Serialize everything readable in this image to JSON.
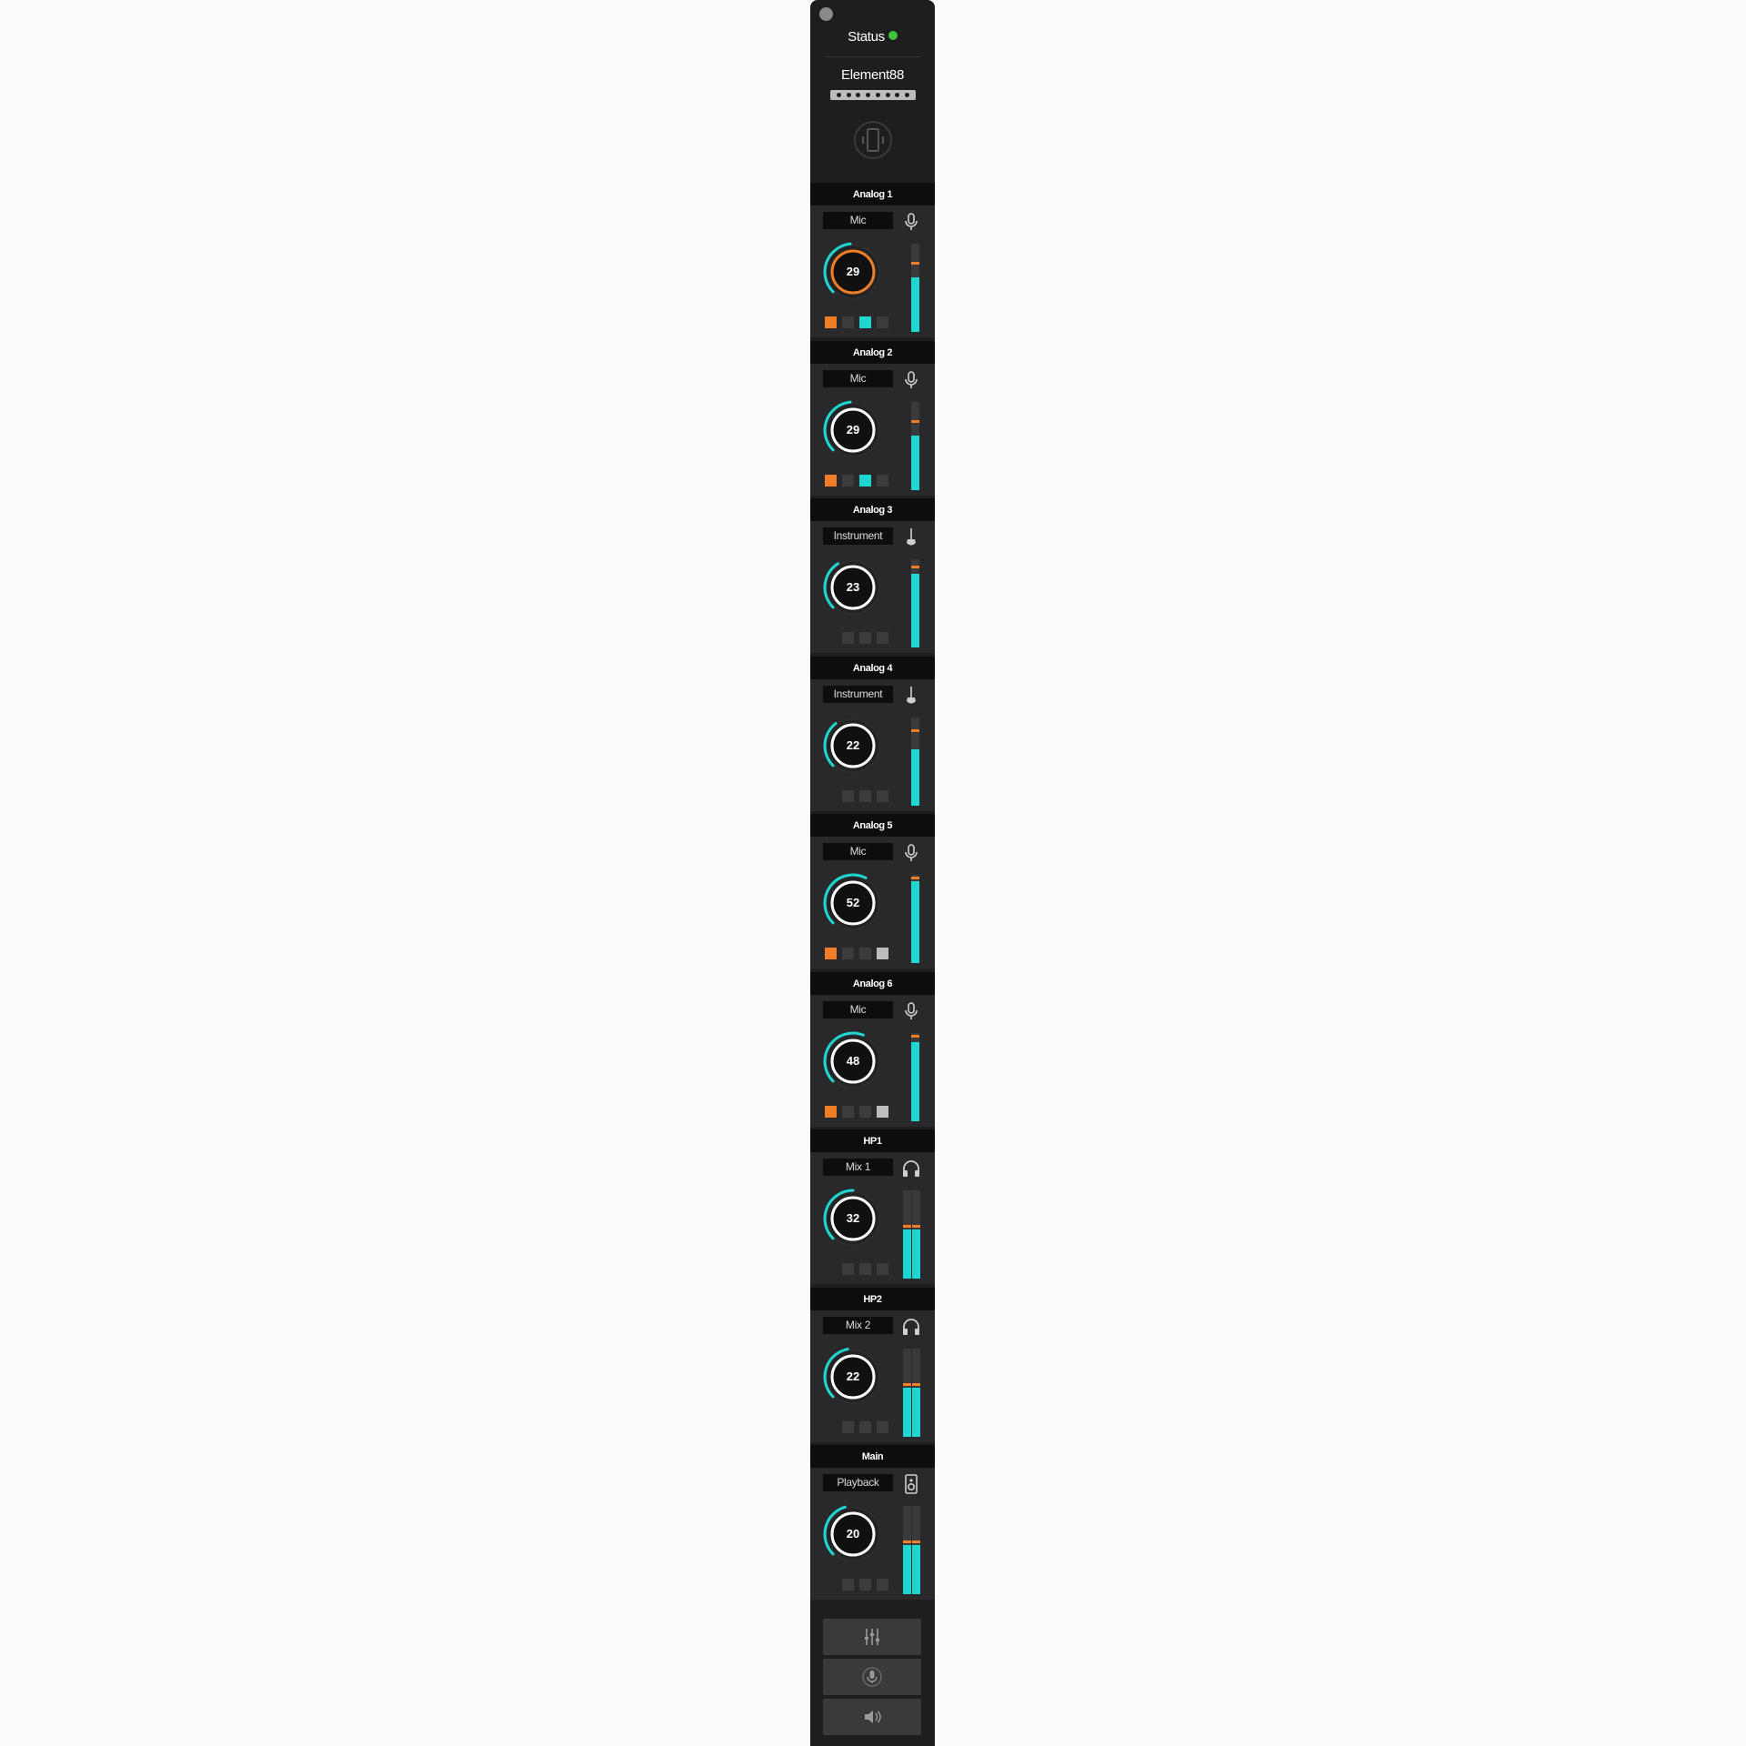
{
  "window": {
    "close_button": "close"
  },
  "status": {
    "label": "Status",
    "color": "#3ec33e"
  },
  "device": {
    "name": "Element88",
    "port_count": 8,
    "icon": "device-sync-icon"
  },
  "colors": {
    "accent": "#1fd6d0",
    "warning": "#f07e26",
    "background": "#1e1e1f"
  },
  "channels": [
    {
      "name": "Analog 1",
      "source": "Mic",
      "icon": "microphone-icon",
      "gain": "29",
      "gain_fraction": 0.48,
      "ring": "#f07e26",
      "buttons": [
        "#f07e26",
        "#3c3c3e",
        "#1fd6d0",
        "#3c3c3e"
      ],
      "meters": [
        {
          "level": 0.62,
          "peak": 0.76
        }
      ]
    },
    {
      "name": "Analog 2",
      "source": "Mic",
      "icon": "microphone-icon",
      "gain": "29",
      "gain_fraction": 0.48,
      "ring": "#ffffff",
      "buttons": [
        "#f07e26",
        "#3c3c3e",
        "#1fd6d0",
        "#3c3c3e"
      ],
      "meters": [
        {
          "level": 0.62,
          "peak": 0.76
        }
      ]
    },
    {
      "name": "Analog 3",
      "source": "Instrument",
      "icon": "guitar-icon",
      "gain": "23",
      "gain_fraction": 0.38,
      "ring": "#ffffff",
      "buttons": [
        null,
        "#3c3c3e",
        "#3c3c3e",
        "#3c3c3e"
      ],
      "meters": [
        {
          "level": 0.84,
          "peak": 0.9
        }
      ]
    },
    {
      "name": "Analog 4",
      "source": "Instrument",
      "icon": "guitar-icon",
      "gain": "22",
      "gain_fraction": 0.36,
      "ring": "#ffffff",
      "buttons": [
        null,
        "#3c3c3e",
        "#3c3c3e",
        "#3c3c3e"
      ],
      "meters": [
        {
          "level": 0.64,
          "peak": 0.84
        }
      ]
    },
    {
      "name": "Analog 5",
      "source": "Mic",
      "icon": "microphone-icon",
      "gain": "52",
      "gain_fraction": 0.6,
      "ring": "#ffffff",
      "buttons": [
        "#f07e26",
        "#3c3c3e",
        "#3c3c3e",
        "#bdbdbf"
      ],
      "meters": [
        {
          "level": 0.93,
          "peak": 0.95
        }
      ]
    },
    {
      "name": "Analog 6",
      "source": "Mic",
      "icon": "microphone-icon",
      "gain": "48",
      "gain_fraction": 0.58,
      "ring": "#ffffff",
      "buttons": [
        "#f07e26",
        "#3c3c3e",
        "#3c3c3e",
        "#bdbdbf"
      ],
      "meters": [
        {
          "level": 0.9,
          "peak": 0.95
        }
      ]
    },
    {
      "name": "HP1",
      "source": "Mix 1",
      "icon": "headphones-icon",
      "gain": "32",
      "gain_fraction": 0.5,
      "ring": "#ffffff",
      "buttons": [
        null,
        "#3c3c3e",
        "#3c3c3e",
        "#3c3c3e"
      ],
      "meters": [
        {
          "level": 0.56,
          "peak": 0.58
        },
        {
          "level": 0.56,
          "peak": 0.58
        }
      ]
    },
    {
      "name": "HP2",
      "source": "Mix 2",
      "icon": "headphones-icon",
      "gain": "22",
      "gain_fraction": 0.46,
      "ring": "#ffffff",
      "buttons": [
        null,
        "#3c3c3e",
        "#3c3c3e",
        "#3c3c3e"
      ],
      "meters": [
        {
          "level": 0.56,
          "peak": 0.58
        },
        {
          "level": 0.56,
          "peak": 0.58
        }
      ]
    },
    {
      "name": "Main",
      "source": "Playback",
      "icon": "speaker-icon",
      "gain": "20",
      "gain_fraction": 0.44,
      "ring": "#ffffff",
      "buttons": [
        null,
        "#3c3c3e",
        "#3c3c3e",
        "#3c3c3e"
      ],
      "meters": [
        {
          "level": 0.56,
          "peak": 0.58
        },
        {
          "level": 0.56,
          "peak": 0.58
        }
      ]
    }
  ],
  "bottom_buttons": [
    {
      "icon": "mixer-faders-icon"
    },
    {
      "icon": "microphone-icon"
    },
    {
      "icon": "speaker-volume-icon"
    }
  ]
}
